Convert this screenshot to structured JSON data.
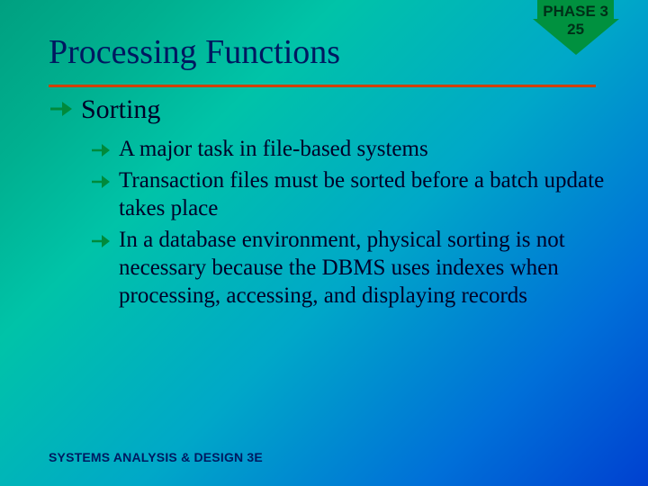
{
  "badge": {
    "phase_label": "PHASE 3",
    "number": "25"
  },
  "title": "Processing Functions",
  "bullets": {
    "main": "Sorting",
    "sub": [
      "A major task in file-based systems",
      "Transaction files must be sorted before a batch update takes place",
      "In a database environment, physical sorting is not necessary because the DBMS uses indexes when processing, accessing, and displaying records"
    ]
  },
  "footer": "SYSTEMS ANALYSIS & DESIGN 3E",
  "colors": {
    "bullet_arrow": "#008a3c"
  }
}
